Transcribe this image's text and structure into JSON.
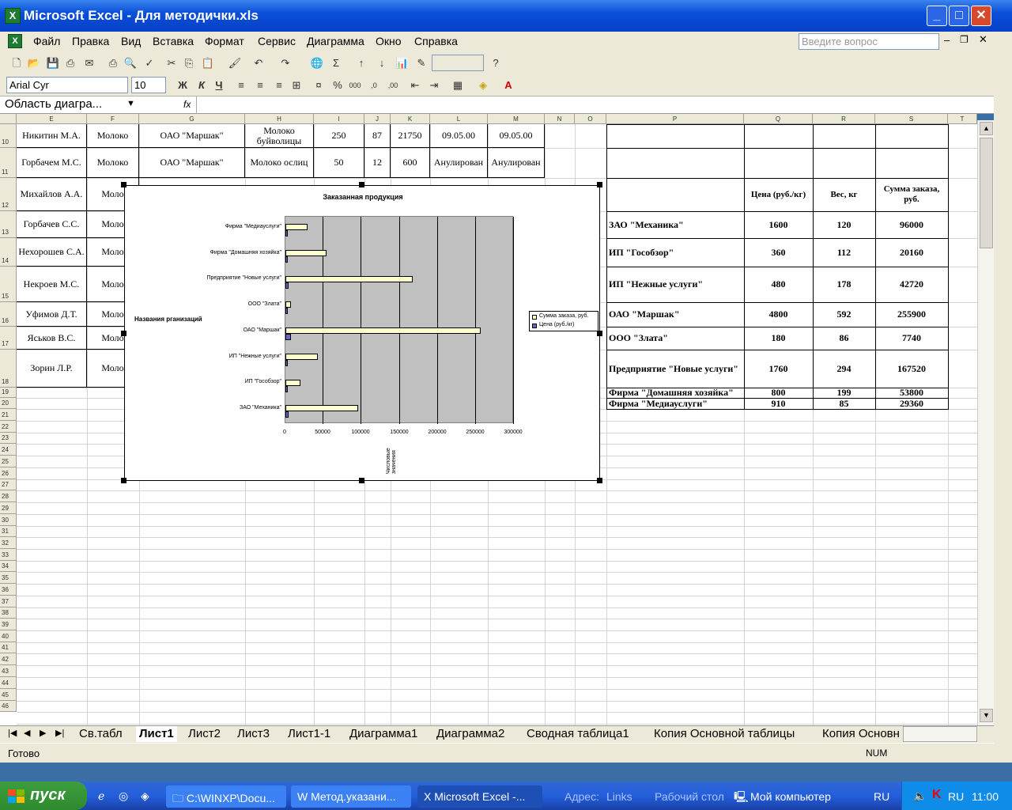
{
  "window": {
    "title": "Microsoft Excel - Для методички.xls"
  },
  "menu": [
    "Файл",
    "Правка",
    "Вид",
    "Вставка",
    "Формат",
    "Сервис",
    "Диаграмма",
    "Окно",
    "Справка"
  ],
  "help_placeholder": "Введите вопрос",
  "font_name": "Arial Cyr",
  "font_size": "10",
  "name_box": "Область диагра...",
  "fx": "fx",
  "columns": [
    "E",
    "F",
    "G",
    "H",
    "I",
    "J",
    "K",
    "L",
    "M",
    "N",
    "O",
    "P",
    "Q",
    "R",
    "S",
    "T"
  ],
  "rows": [
    "10",
    "11",
    "12",
    "13",
    "14",
    "15",
    "16",
    "17",
    "18",
    "19",
    "20",
    "21",
    "22",
    "23",
    "24",
    "25",
    "26",
    "27",
    "28",
    "29",
    "30",
    "31",
    "32",
    "33",
    "34",
    "35",
    "36",
    "37",
    "38",
    "39",
    "40",
    "41",
    "42",
    "43",
    "44",
    "45",
    "46"
  ],
  "left_table": [
    [
      "Никитин М.А.",
      "Молоко",
      "ОАО \"Маршак\"",
      "Молоко буйволицы",
      "250",
      "87",
      "21750",
      "09.05.00",
      "09.05.00"
    ],
    [
      "Горбачем М.С.",
      "Молоко",
      "ОАО \"Маршак\"",
      "Молоко ослиц",
      "50",
      "12",
      "600",
      "Анулирован",
      "Анулирован"
    ],
    [
      "Михайлов А.А.",
      "Моло"
    ],
    [
      "Горбачев С.С.",
      "Моло"
    ],
    [
      "Нехорошев С.А.",
      "Моло"
    ],
    [
      "Некроев М.С.",
      "Моло"
    ],
    [
      "Уфимов Д.Т.",
      "Моло"
    ],
    [
      "Яськов В.С.",
      "Моло"
    ],
    [
      "Зорин Л.Р.",
      "Моло"
    ]
  ],
  "right_table": {
    "headers": [
      "Цена (руб./кг)",
      "Вес, кг",
      "Сумма заказа, руб."
    ],
    "rows": [
      [
        "ЗАО \"Механика\"",
        "1600",
        "120",
        "96000"
      ],
      [
        "ИП \"Гособзор\"",
        "360",
        "112",
        "20160"
      ],
      [
        "ИП \"Нежные услуги\"",
        "480",
        "178",
        "42720"
      ],
      [
        "ОАО \"Маршак\"",
        "4800",
        "592",
        "255900"
      ],
      [
        "ООО \"Злата\"",
        "180",
        "86",
        "7740"
      ],
      [
        "Предприятие \"Новые услуги\"",
        "1760",
        "294",
        "167520"
      ],
      [
        "Фирма \"Домашняя хозяйка\"",
        "800",
        "199",
        "53800"
      ],
      [
        "Фирма \"Медиауслуги\"",
        "910",
        "85",
        "29360"
      ]
    ]
  },
  "chart_data": {
    "type": "bar",
    "orientation": "horizontal",
    "title": "Заказанная продукция",
    "ylabel": "Названия рганизаций",
    "xlabel": "Числовые значения",
    "categories": [
      "ЗАО \"Механика\"",
      "ИП \"Гособзор\"",
      "ИП \"Нежные услуги\"",
      "ОАО \"Маршак\"",
      "ООО \"Злата\"",
      "Предприятие \"Новые услуги\"",
      "Фирма \"Домашняя хозяйка\"",
      "Фирма \"Медиауслуги\""
    ],
    "series": [
      {
        "name": "Сумма заказа, руб.",
        "values": [
          96000,
          20160,
          42720,
          255900,
          7740,
          167520,
          53800,
          29360
        ],
        "color": "#ffffcc"
      },
      {
        "name": "Цена (руб./кг)",
        "values": [
          1600,
          360,
          480,
          4800,
          180,
          1760,
          800,
          910
        ],
        "color": "#6666cc"
      }
    ],
    "xlim": [
      0,
      300000
    ],
    "xticks": [
      "0",
      "50000",
      "100000",
      "150000",
      "200000",
      "250000",
      "300000"
    ],
    "legend": "right",
    "plot_background": "#c0c0c0"
  },
  "sheet_tabs": [
    "Св.табл",
    "Лист1",
    "Лист2",
    "Лист3",
    "Лист1-1",
    "Диаграмма1",
    "Диаграмма2",
    "Сводная таблица1",
    "Копия Основной таблицы",
    "Копия Основн"
  ],
  "active_tab": "Лист1",
  "status": {
    "left": "Готово",
    "num": "NUM"
  },
  "taskbar": {
    "start": "пуск",
    "items": [
      "C:\\WINXP\\Docu...",
      "Метод.указани...",
      "Microsoft Excel -..."
    ],
    "address_label": "Адрес:",
    "links": "Links",
    "desktop": "Рабочий стол",
    "mycomp": "Мой компьютер",
    "lang": "RU",
    "lang2": "RU",
    "clock": "11:00"
  }
}
